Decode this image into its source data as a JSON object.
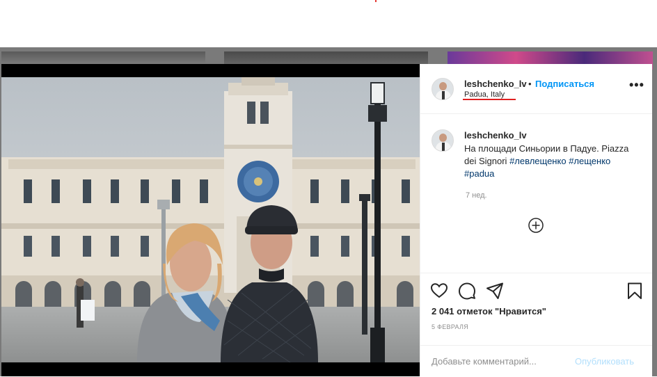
{
  "post": {
    "username": "leshchenko_lv",
    "bullet": "•",
    "follow_label": "Подписаться",
    "location": "Padua, Italy",
    "more_label": "•••"
  },
  "caption": {
    "username": "leshchenko_lv",
    "text": "На площади Синьории в Падуе. Piazza dei Signori",
    "hashtags": [
      "#левлещенко",
      "#лещенко",
      "#padua"
    ],
    "age": "7 нед."
  },
  "actions": {
    "icons": [
      "heart-icon",
      "comment-icon",
      "send-icon",
      "bookmark-icon",
      "plus-circle-icon"
    ],
    "likes": "2 041 отметок \"Нравится\"",
    "date": "5 ФЕВРАЛЯ"
  },
  "comment_box": {
    "placeholder": "Добавьте комментарий...",
    "publish_label": "Опубликовать"
  },
  "colors": {
    "accent": "#0095f6",
    "hashtag": "#00376b",
    "publish_disabled": "#b2dffc",
    "location_underline": "#e02020"
  }
}
